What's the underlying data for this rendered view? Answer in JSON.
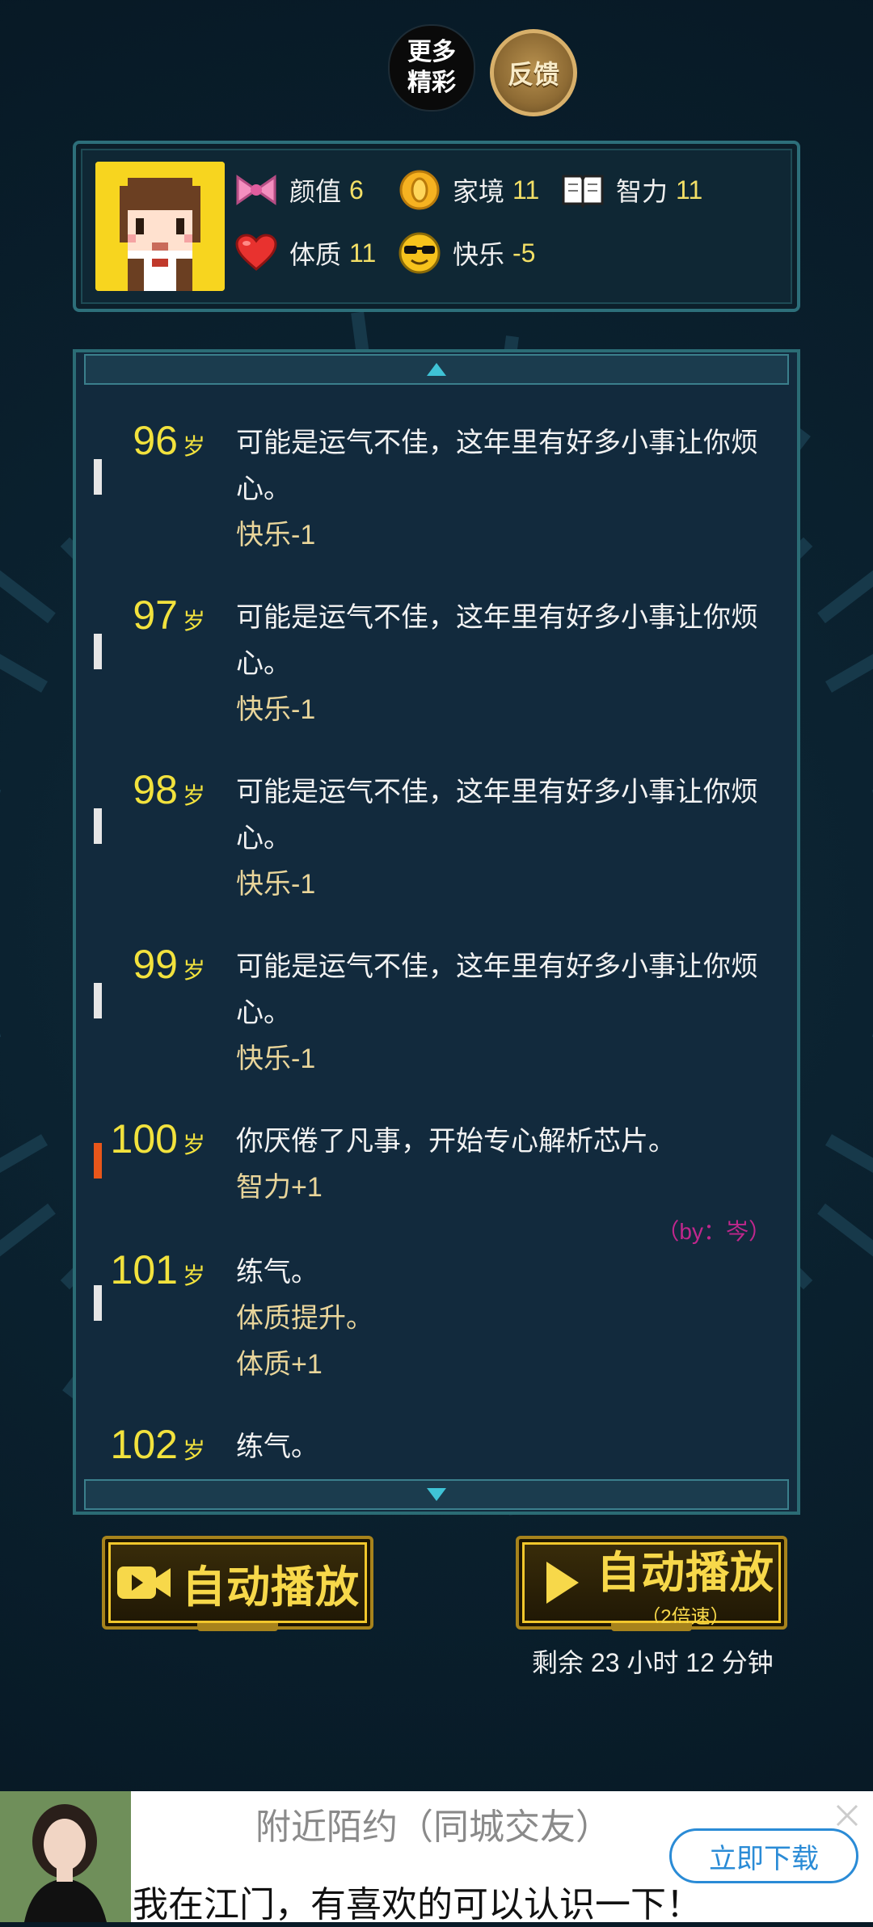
{
  "top_buttons": {
    "more_label": "更多精彩",
    "feedback_label": "反馈"
  },
  "stats": [
    {
      "icon": "bow-icon",
      "label": "颜值",
      "value": "6"
    },
    {
      "icon": "coin-icon",
      "label": "家境",
      "value": "11"
    },
    {
      "icon": "book-icon",
      "label": "智力",
      "value": "11"
    },
    {
      "icon": "heart-icon",
      "label": "体质",
      "value": "11"
    },
    {
      "icon": "sunglasses-face-icon",
      "label": "快乐",
      "value": "-5"
    }
  ],
  "log": {
    "age_suffix": "岁",
    "entries": [
      {
        "age": "96",
        "lines": [
          "可能是运气不佳，这年里有好多小事让你烦心。"
        ],
        "effects": [
          "快乐-1"
        ],
        "marker_color": "#e6e6e6"
      },
      {
        "age": "97",
        "lines": [
          "可能是运气不佳，这年里有好多小事让你烦心。"
        ],
        "effects": [
          "快乐-1"
        ],
        "marker_color": "#e6e6e6"
      },
      {
        "age": "98",
        "lines": [
          "可能是运气不佳，这年里有好多小事让你烦心。"
        ],
        "effects": [
          "快乐-1"
        ],
        "marker_color": "#e6e6e6"
      },
      {
        "age": "99",
        "lines": [
          "可能是运气不佳，这年里有好多小事让你烦心。"
        ],
        "effects": [
          "快乐-1"
        ],
        "marker_color": "#e6e6e6"
      },
      {
        "age": "100",
        "lines": [
          "你厌倦了凡事，开始专心解析芯片。"
        ],
        "effects": [
          "智力+1"
        ],
        "marker_color": "#e8561a",
        "byline": "（by：岑）"
      },
      {
        "age": "101",
        "lines": [
          "练气。"
        ],
        "effects": [
          "体质提升。",
          "体质+1"
        ],
        "marker_color": "#e6e6e6"
      },
      {
        "age": "102",
        "lines": [
          "练气。"
        ],
        "effects": [],
        "marker_color": "#e6e6e6"
      }
    ]
  },
  "controls": {
    "auto_play_label": "自动播放",
    "auto_play_fast_label": "自动播放",
    "auto_play_fast_sub": "（2倍速）",
    "remaining_text": "剩余 23 小时 12 分钟"
  },
  "ad": {
    "title": "附近陌约（同城交友）",
    "body": "我在江门，有喜欢的可以认识一下！",
    "button": "立即下载"
  },
  "colors": {
    "accent_yellow": "#f2e23d",
    "effect_text": "#e9d59a",
    "byline": "#c0278d",
    "panel_border": "#2b6c75"
  }
}
